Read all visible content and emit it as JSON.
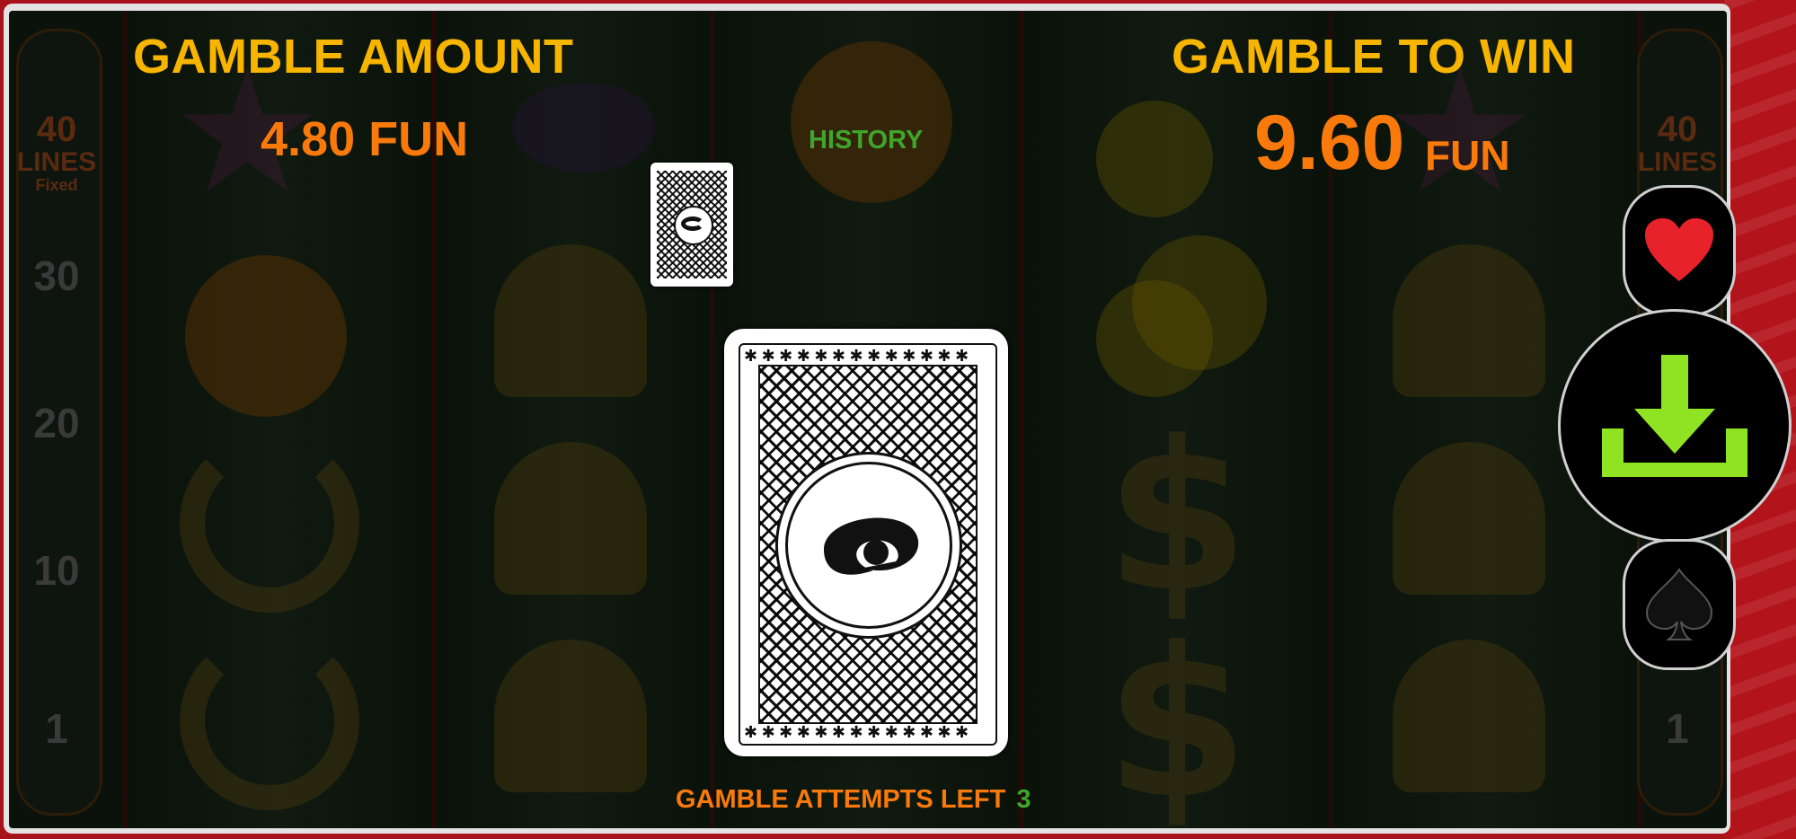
{
  "left_panel": {
    "title": "GAMBLE AMOUNT",
    "value": "4.80 FUN"
  },
  "right_panel": {
    "title": "GAMBLE TO WIN",
    "value": "9.60",
    "currency": "FUN"
  },
  "history": {
    "label": "HISTORY"
  },
  "attempts": {
    "label": "GAMBLE ATTEMPTS LEFT",
    "count": "3"
  },
  "sidebar": {
    "lines_count": "40",
    "lines_label": "LINES",
    "fixed_label": "Fixed",
    "numbers": [
      "30",
      "20",
      "10",
      "1"
    ]
  },
  "controls": {
    "red_choice": "heart-icon",
    "black_choice": "spade-icon",
    "collect": "download-icon"
  },
  "colors": {
    "title": "#f7b500",
    "amount": "#f97a0b",
    "history": "#3ea62b",
    "collect_arrow": "#8fe322"
  }
}
